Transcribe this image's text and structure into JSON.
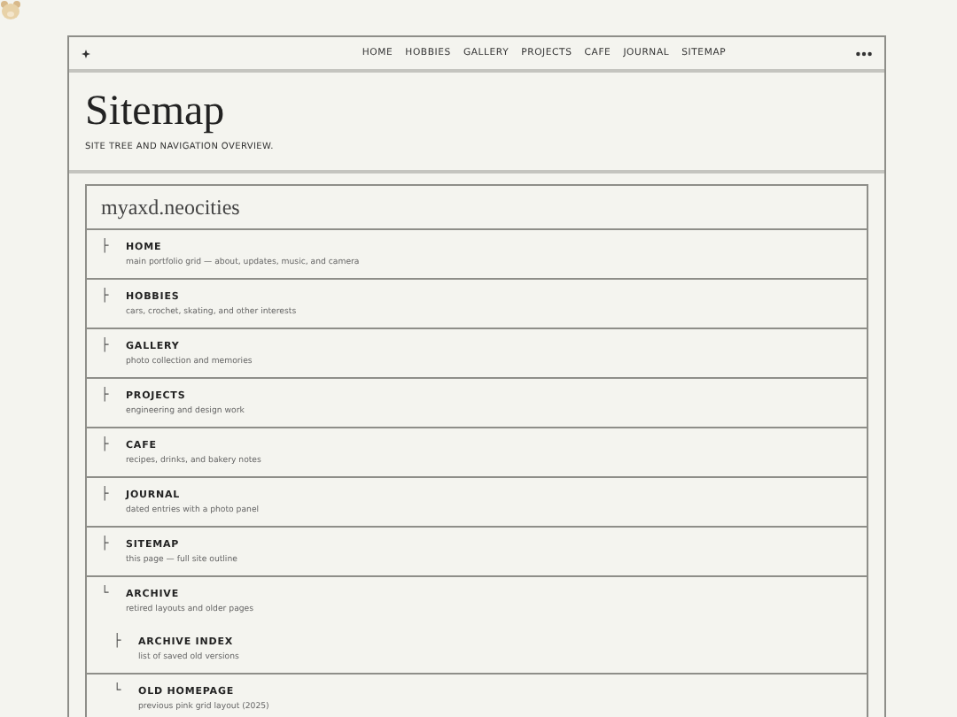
{
  "nav": {
    "items": [
      "HOME",
      "HOBBIES",
      "GALLERY",
      "PROJECTS",
      "CAFE",
      "JOURNAL",
      "SITEMAP"
    ]
  },
  "header": {
    "title": "Sitemap",
    "subtitle": "SITE TREE AND NAVIGATION OVERVIEW."
  },
  "tree": {
    "title": "myaxd.neocities",
    "items": [
      {
        "branch": "├",
        "label": "HOME",
        "description": "main portfolio grid — about, updates, music, and camera"
      },
      {
        "branch": "├",
        "label": "HOBBIES",
        "description": "cars, crochet, skating, and other interests"
      },
      {
        "branch": "├",
        "label": "GALLERY",
        "description": "photo collection and memories"
      },
      {
        "branch": "├",
        "label": "PROJECTS",
        "description": "engineering and design work"
      },
      {
        "branch": "├",
        "label": "CAFE",
        "description": "recipes, drinks, and bakery notes"
      },
      {
        "branch": "├",
        "label": "JOURNAL",
        "description": "dated entries with a photo panel"
      },
      {
        "branch": "├",
        "label": "SITEMAP",
        "description": "this page — full site outline"
      },
      {
        "branch": "└",
        "label": "ARCHIVE",
        "description": "retired layouts and older pages",
        "children": [
          {
            "branch": "├",
            "label": "ARCHIVE INDEX",
            "description": "list of saved old versions"
          },
          {
            "branch": "└",
            "label": "OLD HOMEPAGE",
            "description": "previous pink grid layout (2025)"
          }
        ]
      }
    ]
  }
}
